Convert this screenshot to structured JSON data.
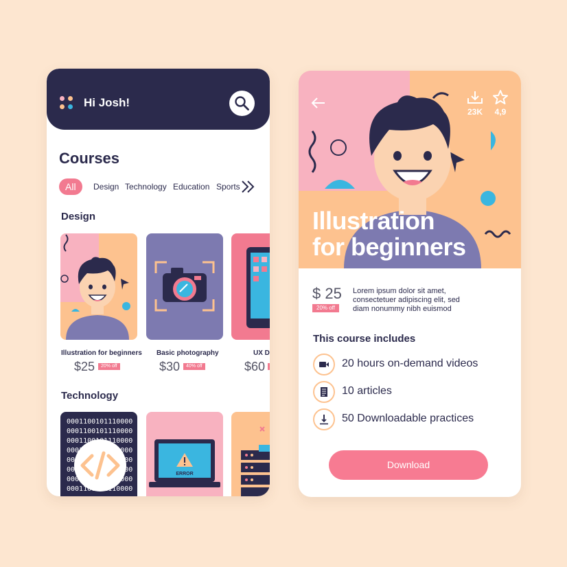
{
  "left_screen": {
    "greeting": "Hi Josh!",
    "courses_title": "Courses",
    "filters": [
      "All",
      "Design",
      "Technology",
      "Education",
      "Sports"
    ],
    "active_filter": "All",
    "sections": [
      {
        "title": "Design",
        "cards": [
          {
            "name": "Illustration for beginners",
            "price": "$25",
            "discount": "20% off"
          },
          {
            "name": "Basic photography",
            "price": "$30",
            "discount": "40% off"
          },
          {
            "name": "UX D",
            "price": "$60",
            "discount": ""
          }
        ]
      },
      {
        "title": "Technology",
        "binary_lines": [
          "0001100101110000",
          "0001100101110000",
          "0001100101110000",
          "0001100101110000",
          "0001100101110000",
          "0001100101110000",
          "0001100101110000",
          "0001100101110000"
        ],
        "error_text": "ERROR"
      }
    ]
  },
  "right_screen": {
    "downloads": "23K",
    "rating": "4,9",
    "hero_title_line1": "Illustration",
    "hero_title_line2": "for beginners",
    "price": "$ 25",
    "discount": "20% off",
    "description": "Lorem ipsum dolor sit amet, consectetuer adipiscing elit, sed diam nonummy nibh euismod",
    "includes_title": "This course includes",
    "includes": [
      {
        "icon": "video-camera-icon",
        "label": "20 hours on-demand videos"
      },
      {
        "icon": "document-icon",
        "label": "10 articles"
      },
      {
        "icon": "download-arrow-icon",
        "label": "50 Downloadable practices"
      }
    ],
    "download_label": "Download"
  },
  "colors": {
    "background": "#fde6d0",
    "navy": "#2b2a4c",
    "pink": "#f27a90",
    "peach": "#fdc28f",
    "light_pink": "#f8b2c0",
    "purple": "#7d7ab0",
    "cyan": "#3ab6e0"
  }
}
